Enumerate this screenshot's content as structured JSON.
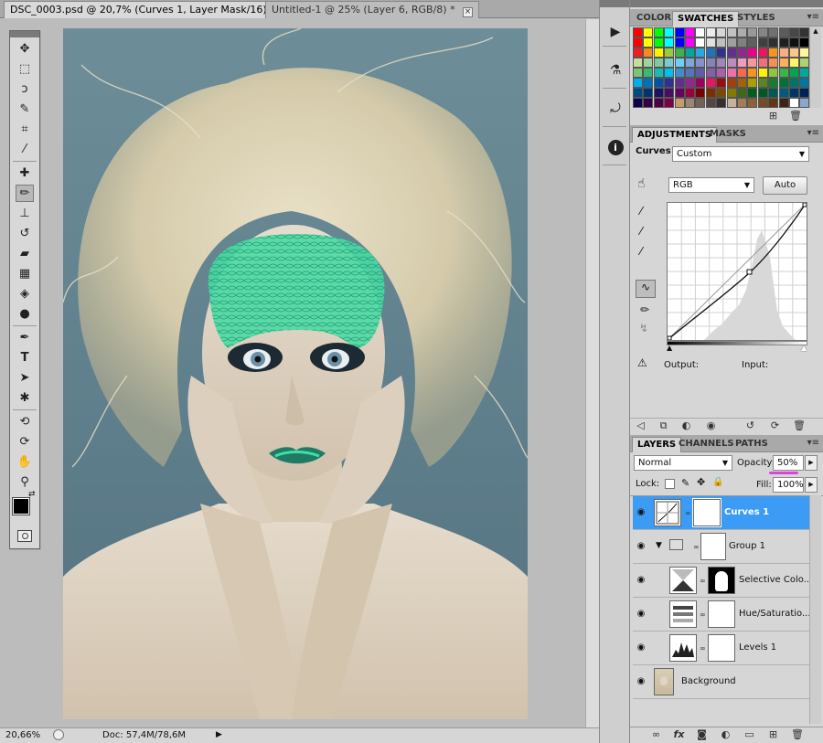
{
  "document": {
    "tabs": [
      {
        "label": "DSC_0003.psd @ 20,7% (Curves 1, Layer Mask/16) *",
        "active": true
      },
      {
        "label": "Untitled-1 @ 25% (Layer 6, RGB/8) *",
        "active": false
      }
    ],
    "close_glyph": "×",
    "status": {
      "zoom": "20,66%",
      "doc_info": "Doc: 57,4M/78,6M"
    }
  },
  "panels": {
    "top_tabs": [
      "COLOR",
      "SWATCHES",
      "STYLES"
    ],
    "adjust_tabs": [
      "ADJUSTMENTS",
      "MASKS"
    ],
    "layers_tabs": [
      "LAYERS",
      "CHANNELS",
      "PATHS"
    ],
    "menu_glyph": "▾≡"
  },
  "swatches": {
    "rows": [
      [
        "#ff0000",
        "#ffff00",
        "#00ff00",
        "#00ffff",
        "#0000ff",
        "#ff00ff",
        "#ffffff",
        "#ebebeb",
        "#d6d6d6",
        "#c2c2c2",
        "#adadad",
        "#999999",
        "#858585",
        "#707070",
        "#5c5c5c",
        "#474747",
        "#333333"
      ],
      [
        "#ff0000",
        "#ffff00",
        "#00ff00",
        "#00ffff",
        "#0000ff",
        "#ff00ff",
        "#ffffff",
        "#e0e0e0",
        "#c0c0c0",
        "#a0a0a0",
        "#808080",
        "#606060",
        "#404040",
        "#303030",
        "#202020",
        "#101010",
        "#000000"
      ],
      [
        "#ee1d24",
        "#f5891f",
        "#fff200",
        "#9bcb3b",
        "#39b54a",
        "#00a99d",
        "#27aae1",
        "#1c75bc",
        "#2e3192",
        "#662d91",
        "#92278f",
        "#ec008c",
        "#ed145b",
        "#f7941d",
        "#f9ad81",
        "#fdc689",
        "#fff799"
      ],
      [
        "#c4df9b",
        "#a3d39c",
        "#82ca9c",
        "#7accc8",
        "#6dcff6",
        "#7da7d9",
        "#8393ca",
        "#8781bd",
        "#a186be",
        "#bd8cbf",
        "#f49ac1",
        "#f5989d",
        "#f26d7d",
        "#f68e55",
        "#fbaf5c",
        "#fff568",
        "#acd373"
      ],
      [
        "#7cc576",
        "#3bb878",
        "#1abbb4",
        "#00bff3",
        "#438ccb",
        "#5574b9",
        "#605ca8",
        "#855fa8",
        "#a763a8",
        "#f06ea9",
        "#f26c4f",
        "#f7941d",
        "#fff200",
        "#8dc63f",
        "#39b54a",
        "#00a651",
        "#00a99d"
      ],
      [
        "#00aeef",
        "#0072bc",
        "#0054a6",
        "#2e3192",
        "#662d91",
        "#92278f",
        "#9e005d",
        "#ed145b",
        "#9e0b0f",
        "#a0410d",
        "#a36209",
        "#aba000",
        "#598527",
        "#197b30",
        "#007236",
        "#00746b",
        "#0076a3"
      ],
      [
        "#004a80",
        "#003471",
        "#1b1464",
        "#440e62",
        "#630460",
        "#9e0039",
        "#790000",
        "#7b2e00",
        "#7d4900",
        "#827b00",
        "#406618",
        "#005e20",
        "#005826",
        "#005952",
        "#005b7f",
        "#003663",
        "#002157"
      ],
      [
        "#0d004c",
        "#32004b",
        "#4b0049",
        "#7b0046",
        "#c69c6d",
        "#998675",
        "#736357",
        "#534741",
        "#362f2d",
        "#c7b299",
        "#a67c52",
        "#8c6239",
        "#754c24",
        "#603913",
        "#3c2415",
        "#ffffff",
        "#8ba8c8"
      ]
    ]
  },
  "adjustments": {
    "title": "Curves",
    "preset": "Custom",
    "channel": "RGB",
    "auto_label": "Auto",
    "output_label": "Output:",
    "input_label": "Input:"
  },
  "layers": {
    "blend_mode": "Normal",
    "opacity_label": "Opacity:",
    "opacity_value": "50%",
    "lock_label": "Lock:",
    "fill_label": "Fill:",
    "fill_value": "100%",
    "items": [
      {
        "name": "Curves 1",
        "selected": true
      },
      {
        "name": "Group 1",
        "selected": false
      },
      {
        "name": "Selective Colo...",
        "selected": false
      },
      {
        "name": "Hue/Saturatio...",
        "selected": false
      },
      {
        "name": "Levels 1",
        "selected": false
      },
      {
        "name": "Background",
        "selected": false
      }
    ]
  },
  "colors": {
    "selected_layer": "#3b9bf5",
    "opacity_underline": "#e040e0",
    "green_paint": "#2fd39a"
  }
}
